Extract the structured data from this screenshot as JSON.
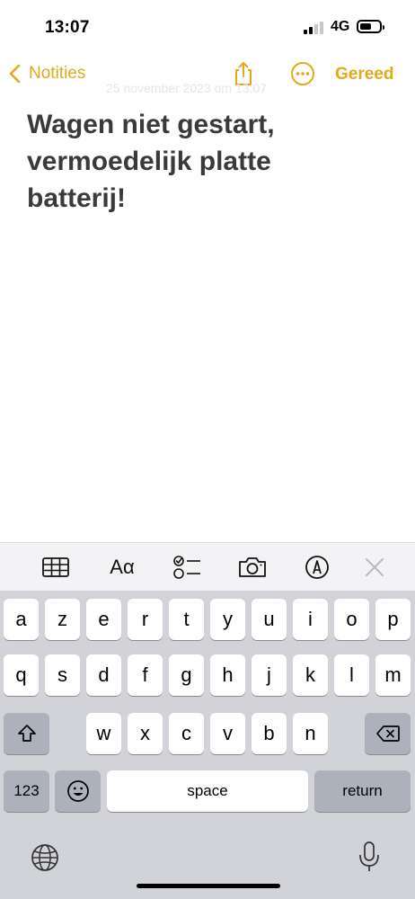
{
  "status_bar": {
    "time": "13:07",
    "network": "4G"
  },
  "nav": {
    "back_label": "Notities",
    "done_label": "Gereed"
  },
  "note": {
    "ghost_date": "25 november 2023 om 13:07",
    "title_lines": [
      "Wagen niet gestart,",
      "vermoedelijk platte",
      "batterij!"
    ]
  },
  "format_bar": {
    "text_style_label": "Aα"
  },
  "keyboard": {
    "row1": [
      "a",
      "z",
      "e",
      "r",
      "t",
      "y",
      "u",
      "i",
      "o",
      "p"
    ],
    "row2": [
      "q",
      "s",
      "d",
      "f",
      "g",
      "h",
      "j",
      "k",
      "l",
      "m"
    ],
    "row3": [
      "w",
      "x",
      "c",
      "v",
      "b",
      "n"
    ],
    "numbers_label": "123",
    "space_label": "space",
    "return_label": "return"
  },
  "colors": {
    "accent": "#e5a81b",
    "keyboard_bg": "#d1d3d9",
    "dark_key": "#adb1bb"
  }
}
